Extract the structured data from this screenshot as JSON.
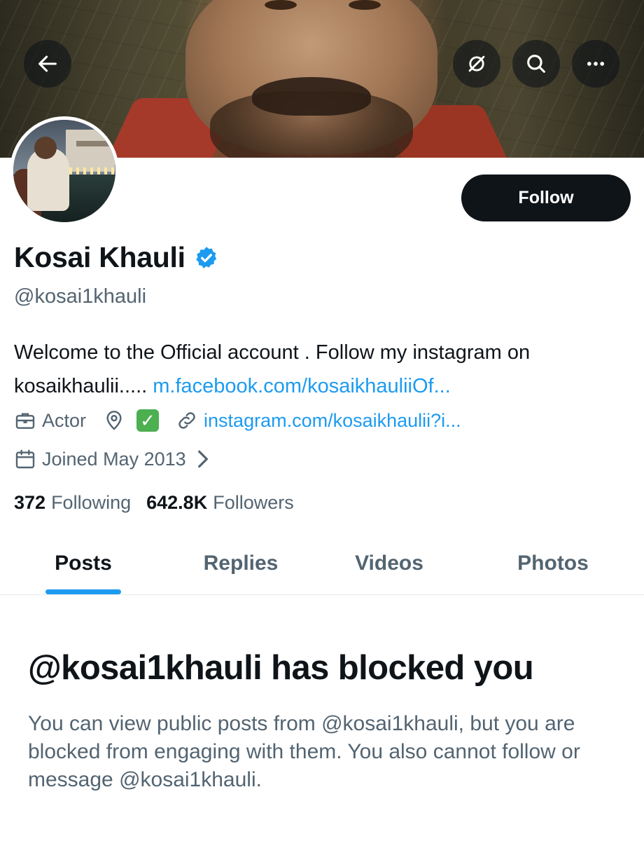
{
  "header": {
    "back_icon": "arrow-left-icon",
    "icons": [
      "grok-icon",
      "search-icon",
      "more-icon"
    ]
  },
  "profile": {
    "name": "Kosai Khauli",
    "verified": true,
    "handle": "@kosai1khauli",
    "follow_label": "Follow",
    "bio_text": "Welcome to the Official account . Follow my instagram on kosaikhaulii..... ",
    "bio_link": "m.facebook.com/kosaikhauliiOf...",
    "category": "Actor",
    "location": "✓",
    "website": "instagram.com/kosaikhaulii?i...",
    "joined": "Joined May 2013",
    "following_count": "372",
    "following_label": "Following",
    "followers_count": "642.8K",
    "followers_label": "Followers"
  },
  "tabs": [
    {
      "label": "Posts",
      "active": true
    },
    {
      "label": "Replies",
      "active": false
    },
    {
      "label": "Videos",
      "active": false
    },
    {
      "label": "Photos",
      "active": false
    }
  ],
  "blocked": {
    "title": "@kosai1khauli has blocked you",
    "message": "You can view public posts from @kosai1khauli, but you are blocked from engaging with them. You also cannot follow or message @kosai1khauli."
  },
  "colors": {
    "accent": "#1d9bf0",
    "text_primary": "#0f1419",
    "text_secondary": "#536471",
    "verified_badge": "#1d9bf0"
  }
}
